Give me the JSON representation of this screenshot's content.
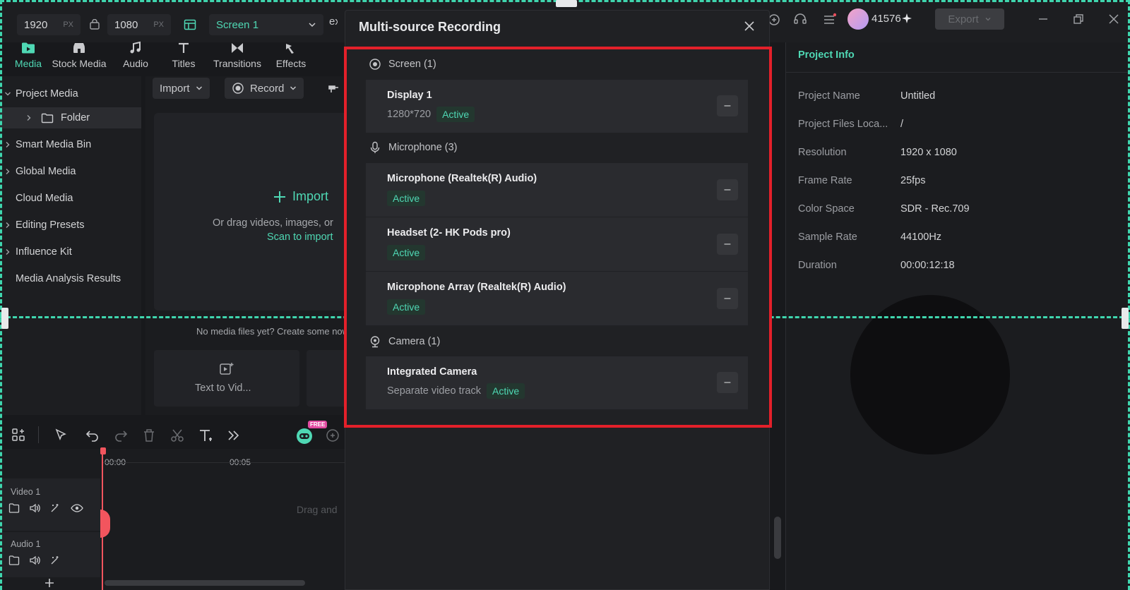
{
  "topbar": {
    "width_value": "1920",
    "height_value": "1080",
    "unit": "PX",
    "screen_select": "Screen 1",
    "user_count": "41576",
    "export_label": "Export"
  },
  "tabs": [
    {
      "label": "Media",
      "icon": "folder-media-icon"
    },
    {
      "label": "Stock Media",
      "icon": "stock-media-icon"
    },
    {
      "label": "Audio",
      "icon": "music-note-icon"
    },
    {
      "label": "Titles",
      "icon": "text-t-icon"
    },
    {
      "label": "Transitions",
      "icon": "transition-icon"
    },
    {
      "label": "Effects",
      "icon": "effects-icon"
    }
  ],
  "sidebar": {
    "items": [
      {
        "label": "Project Media"
      },
      {
        "label": "Folder"
      },
      {
        "label": "Smart Media Bin"
      },
      {
        "label": "Global Media"
      },
      {
        "label": "Cloud Media"
      },
      {
        "label": "Editing Presets"
      },
      {
        "label": "Influence Kit"
      },
      {
        "label": "Media Analysis Results"
      }
    ]
  },
  "media": {
    "import_label": "Import",
    "record_label": "Record",
    "drop_import": "Import",
    "drop_hint": "Or drag videos, images, or",
    "scan_link": "Scan to import",
    "empty_hint": "No media files yet? Create some now",
    "text_to_video": "Text to Vid..."
  },
  "right_panel": {
    "title": "Project Info",
    "rows": [
      {
        "label": "Project Name",
        "value": "Untitled"
      },
      {
        "label": "Project Files Loca...",
        "value": "/"
      },
      {
        "label": "Resolution",
        "value": "1920 x 1080"
      },
      {
        "label": "Frame Rate",
        "value": "25fps"
      },
      {
        "label": "Color Space",
        "value": "SDR - Rec.709"
      },
      {
        "label": "Sample Rate",
        "value": "44100Hz"
      },
      {
        "label": "Duration",
        "value": "00:00:12:18"
      }
    ]
  },
  "timeline": {
    "t0": "00:00",
    "t1": "00:05",
    "video_track": "Video 1",
    "audio_track": "Audio 1",
    "drag_hint": "Drag and",
    "free_badge": "FREE"
  },
  "modal": {
    "title": "Multi-source Recording",
    "screen_header": "Screen (1)",
    "display_name": "Display 1",
    "display_res": "1280*720",
    "mic_header": "Microphone (3)",
    "mics": [
      {
        "name": "Microphone (Realtek(R) Audio)",
        "status": "Active"
      },
      {
        "name": "Headset (2- HK Pods pro)",
        "status": "Active"
      },
      {
        "name": "Microphone Array (Realtek(R) Audio)",
        "status": "Active"
      }
    ],
    "camera_header": "Camera (1)",
    "camera_name": "Integrated Camera",
    "camera_sub": "Separate video track",
    "active": "Active",
    "remove_symbol": "–"
  },
  "colors": {
    "accent": "#4fd8b4",
    "highlight_frame": "#e3202a",
    "selection_dash": "#3fd6ae"
  }
}
